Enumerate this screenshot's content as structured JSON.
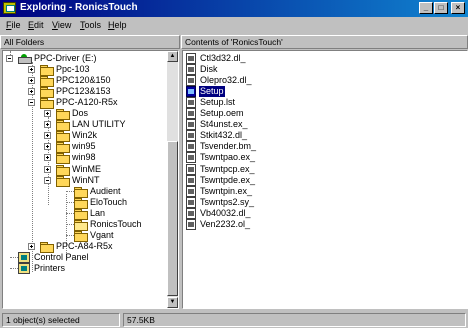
{
  "window": {
    "title": "Exploring - RonicsTouch"
  },
  "menu": [
    {
      "label": "File",
      "key": "F",
      "rest": "ile"
    },
    {
      "label": "Edit",
      "key": "E",
      "rest": "dit"
    },
    {
      "label": "View",
      "key": "V",
      "rest": "iew"
    },
    {
      "label": "Tools",
      "key": "T",
      "rest": "ools"
    },
    {
      "label": "Help",
      "key": "H",
      "rest": "elp"
    }
  ],
  "left_header": "All Folders",
  "right_header": "Contents of 'RonicsTouch'",
  "tree": [
    {
      "label": "PPC-Driver (E:)",
      "icon": "drive-icon",
      "level": 0,
      "expander": "minus"
    },
    {
      "label": "Ppc-103",
      "icon": "folder-icon",
      "level": 1,
      "expander": "plus"
    },
    {
      "label": "PPC120&150",
      "icon": "folder-icon",
      "level": 1,
      "expander": "plus"
    },
    {
      "label": "PPC123&153",
      "icon": "folder-icon",
      "level": 1,
      "expander": "plus"
    },
    {
      "label": "PPC-A120-R5x",
      "icon": "folder-icon",
      "level": 1,
      "expander": "minus"
    },
    {
      "label": "Dos",
      "icon": "folder-icon",
      "level": 2,
      "expander": "plus"
    },
    {
      "label": "LAN UTILITY",
      "icon": "folder-icon",
      "level": 2,
      "expander": "plus"
    },
    {
      "label": "Win2k",
      "icon": "folder-icon",
      "level": 2,
      "expander": "plus"
    },
    {
      "label": "win95",
      "icon": "folder-icon",
      "level": 2,
      "expander": "plus"
    },
    {
      "label": "win98",
      "icon": "folder-icon",
      "level": 2,
      "expander": "plus"
    },
    {
      "label": "WinME",
      "icon": "folder-icon",
      "level": 2,
      "expander": "plus"
    },
    {
      "label": "WinNT",
      "icon": "folder-icon",
      "level": 2,
      "expander": "minus"
    },
    {
      "label": "Audient",
      "icon": "folder-icon",
      "level": 3,
      "expander": "none"
    },
    {
      "label": "EloTouch",
      "icon": "folder-icon",
      "level": 3,
      "expander": "none"
    },
    {
      "label": "Lan",
      "icon": "folder-icon",
      "level": 3,
      "expander": "none"
    },
    {
      "label": "RonicsTouch",
      "icon": "folder-open-icon",
      "level": 3,
      "expander": "none"
    },
    {
      "label": "Vgant",
      "icon": "folder-icon",
      "level": 3,
      "expander": "none"
    },
    {
      "label": "PPC-A84-R5x",
      "icon": "folder-icon",
      "level": 1,
      "expander": "plus"
    },
    {
      "label": "Control Panel",
      "icon": "control-panel-icon",
      "level": 0,
      "expander": "none"
    },
    {
      "label": "Printers",
      "icon": "printers-icon",
      "level": 0,
      "expander": "none"
    }
  ],
  "files": [
    {
      "name": "Ctl3d32.dl_",
      "icon": "file-icon",
      "selected": false
    },
    {
      "name": "Disk",
      "icon": "file-icon",
      "selected": false
    },
    {
      "name": "Olepro32.dl_",
      "icon": "file-icon",
      "selected": false
    },
    {
      "name": "Setup",
      "icon": "setup-icon",
      "selected": true
    },
    {
      "name": "Setup.lst",
      "icon": "file-icon",
      "selected": false
    },
    {
      "name": "Setup.oem",
      "icon": "file-icon",
      "selected": false
    },
    {
      "name": "St4unst.ex_",
      "icon": "file-icon",
      "selected": false
    },
    {
      "name": "Stkit432.dl_",
      "icon": "file-icon",
      "selected": false
    },
    {
      "name": "Tsvender.bm_",
      "icon": "file-icon",
      "selected": false
    },
    {
      "name": "Tswntpao.ex_",
      "icon": "file-icon",
      "selected": false
    },
    {
      "name": "Tswntpcp.ex_",
      "icon": "file-icon",
      "selected": false
    },
    {
      "name": "Tswntpde.ex_",
      "icon": "file-icon",
      "selected": false
    },
    {
      "name": "Tswntpin.ex_",
      "icon": "file-icon",
      "selected": false
    },
    {
      "name": "Tswntps2.sy_",
      "icon": "file-icon",
      "selected": false
    },
    {
      "name": "Vb40032.dl_",
      "icon": "file-icon",
      "selected": false
    },
    {
      "name": "Ven2232.ol_",
      "icon": "file-icon",
      "selected": false
    }
  ],
  "status": {
    "selection": "1 object(s) selected",
    "size": "57.5KB"
  },
  "title_buttons": {
    "minimize": "_",
    "maximize": "□",
    "close": "×"
  },
  "scroll_arrows": {
    "up": "▲",
    "down": "▼"
  }
}
